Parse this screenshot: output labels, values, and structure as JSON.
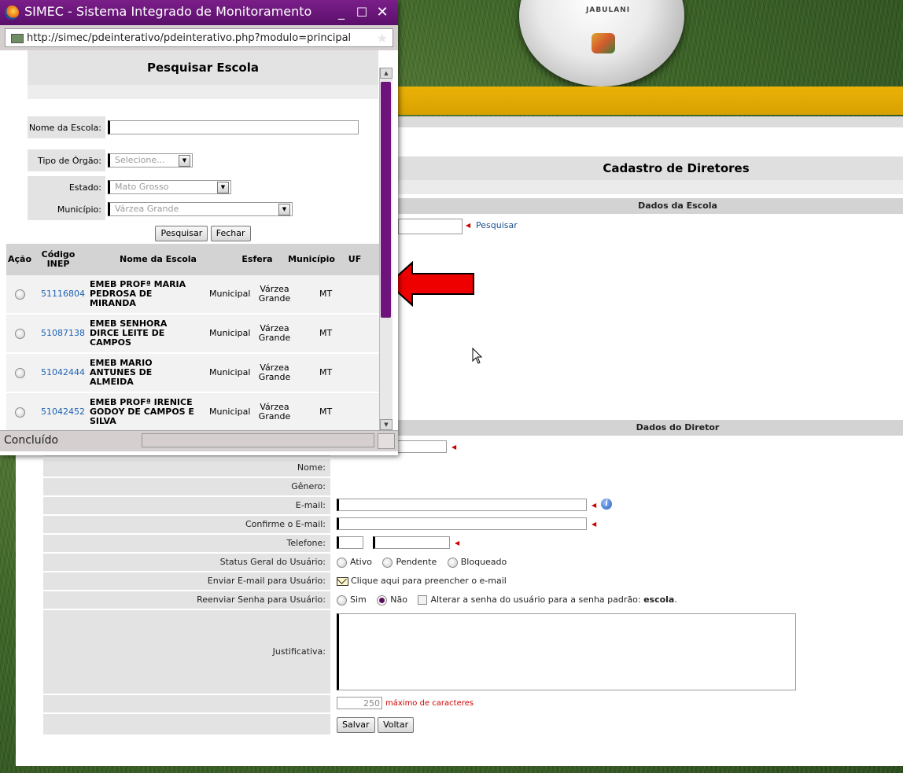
{
  "popup": {
    "title": "SIMEC - Sistema Integrado de Monitoramento",
    "url": "http://simec/pdeinterativo/pdeinterativo.php?modulo=principal",
    "status": "Concluído",
    "search": {
      "title": "Pesquisar Escola",
      "fields": {
        "nome_label": "Nome da Escola:",
        "tipo_label": "Tipo de Órgão:",
        "tipo_value": "Selecione...",
        "estado_label": "Estado:",
        "estado_value": "Mato Grosso",
        "municipio_label": "Município:",
        "municipio_value": "Várzea Grande"
      },
      "buttons": {
        "pesquisar": "Pesquisar",
        "fechar": "Fechar"
      }
    },
    "results": {
      "columns": [
        "Ação",
        "Código INEP",
        "Nome da Escola",
        "Esfera",
        "Município",
        "UF"
      ],
      "rows": [
        {
          "code": "51116804",
          "name": "EMEB PROFª MARIA PEDROSA DE MIRANDA",
          "esfera": "Municipal",
          "municipio": "Várzea Grande",
          "uf": "MT"
        },
        {
          "code": "51087138",
          "name": "EMEB SENHORA DIRCE LEITE DE CAMPOS",
          "esfera": "Municipal",
          "municipio": "Várzea Grande",
          "uf": "MT"
        },
        {
          "code": "51042444",
          "name": "EMEB MARIO ANTUNES DE ALMEIDA",
          "esfera": "Municipal",
          "municipio": "Várzea Grande",
          "uf": "MT"
        },
        {
          "code": "51042452",
          "name": "EMEB PROFª IRENICE GODOY DE CAMPOS E SILVA",
          "esfera": "Municipal",
          "municipio": "Várzea Grande",
          "uf": "MT"
        }
      ]
    }
  },
  "page": {
    "ball_text": "JABULANI",
    "title": "Cadastro de Diretores",
    "sections": {
      "escola": "Dados da Escola",
      "diretor": "Dados do Diretor"
    },
    "pesquisar_link": "Pesquisar",
    "form": {
      "nome": "Nome:",
      "genero": "Gênero:",
      "email": "E-mail:",
      "confirme_email": "Confirme o E-mail:",
      "telefone": "Telefone:",
      "status_label": "Status Geral do Usuário:",
      "status_options": [
        "Ativo",
        "Pendente",
        "Bloqueado"
      ],
      "enviar_label": "Enviar E-mail para Usuário:",
      "enviar_link": "Clique aqui para preencher o e-mail",
      "reenviar_label": "Reenviar Senha para Usuário:",
      "reenviar_sim": "Sim",
      "reenviar_nao": "Não",
      "alterar_senha": "Alterar a senha do usuário para a senha padrão:",
      "senha_padrao": "escola",
      "justificativa_label": "Justificativa:",
      "char_count": "250",
      "max_chars": "máximo de caracteres",
      "salvar": "Salvar",
      "voltar": "Voltar"
    }
  },
  "colors": {
    "purple": "#6e137c",
    "yellow": "#e0a800",
    "required": "#cc0000",
    "link": "#1c62b4"
  }
}
